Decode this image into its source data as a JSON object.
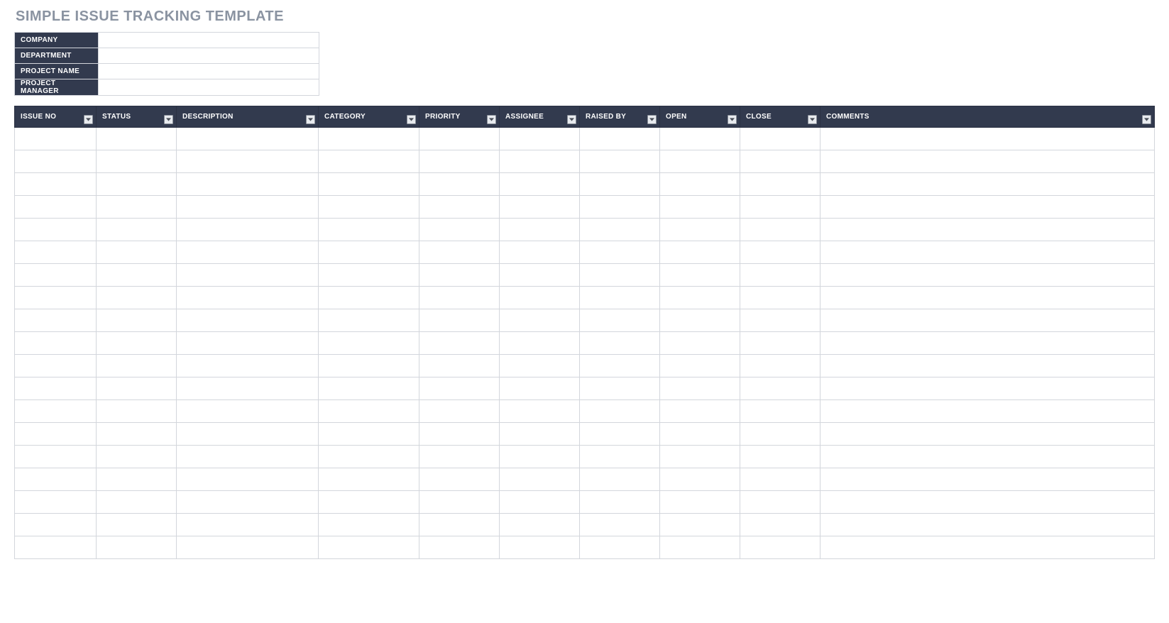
{
  "title": "SIMPLE ISSUE TRACKING TEMPLATE",
  "meta": {
    "rows": [
      {
        "label": "COMPANY",
        "value": ""
      },
      {
        "label": "DEPARTMENT",
        "value": ""
      },
      {
        "label": "PROJECT NAME",
        "value": ""
      },
      {
        "label": "PROJECT MANAGER",
        "value": ""
      }
    ]
  },
  "columns": [
    {
      "key": "issue_no",
      "label": "ISSUE NO"
    },
    {
      "key": "status",
      "label": "STATUS"
    },
    {
      "key": "description",
      "label": "DESCRIPTION"
    },
    {
      "key": "category",
      "label": "CATEGORY"
    },
    {
      "key": "priority",
      "label": "PRIORITY"
    },
    {
      "key": "assignee",
      "label": "ASSIGNEE"
    },
    {
      "key": "raised_by",
      "label": "RAISED BY"
    },
    {
      "key": "open",
      "label": "OPEN"
    },
    {
      "key": "close",
      "label": "CLOSE"
    },
    {
      "key": "comments",
      "label": "COMMENTS"
    }
  ],
  "rows": [
    {
      "issue_no": "",
      "status": "",
      "description": "",
      "category": "",
      "priority": "",
      "assignee": "",
      "raised_by": "",
      "open": "",
      "close": "",
      "comments": ""
    },
    {
      "issue_no": "",
      "status": "",
      "description": "",
      "category": "",
      "priority": "",
      "assignee": "",
      "raised_by": "",
      "open": "",
      "close": "",
      "comments": ""
    },
    {
      "issue_no": "",
      "status": "",
      "description": "",
      "category": "",
      "priority": "",
      "assignee": "",
      "raised_by": "",
      "open": "",
      "close": "",
      "comments": ""
    },
    {
      "issue_no": "",
      "status": "",
      "description": "",
      "category": "",
      "priority": "",
      "assignee": "",
      "raised_by": "",
      "open": "",
      "close": "",
      "comments": ""
    },
    {
      "issue_no": "",
      "status": "",
      "description": "",
      "category": "",
      "priority": "",
      "assignee": "",
      "raised_by": "",
      "open": "",
      "close": "",
      "comments": ""
    },
    {
      "issue_no": "",
      "status": "",
      "description": "",
      "category": "",
      "priority": "",
      "assignee": "",
      "raised_by": "",
      "open": "",
      "close": "",
      "comments": ""
    },
    {
      "issue_no": "",
      "status": "",
      "description": "",
      "category": "",
      "priority": "",
      "assignee": "",
      "raised_by": "",
      "open": "",
      "close": "",
      "comments": ""
    },
    {
      "issue_no": "",
      "status": "",
      "description": "",
      "category": "",
      "priority": "",
      "assignee": "",
      "raised_by": "",
      "open": "",
      "close": "",
      "comments": ""
    },
    {
      "issue_no": "",
      "status": "",
      "description": "",
      "category": "",
      "priority": "",
      "assignee": "",
      "raised_by": "",
      "open": "",
      "close": "",
      "comments": ""
    },
    {
      "issue_no": "",
      "status": "",
      "description": "",
      "category": "",
      "priority": "",
      "assignee": "",
      "raised_by": "",
      "open": "",
      "close": "",
      "comments": ""
    },
    {
      "issue_no": "",
      "status": "",
      "description": "",
      "category": "",
      "priority": "",
      "assignee": "",
      "raised_by": "",
      "open": "",
      "close": "",
      "comments": ""
    },
    {
      "issue_no": "",
      "status": "",
      "description": "",
      "category": "",
      "priority": "",
      "assignee": "",
      "raised_by": "",
      "open": "",
      "close": "",
      "comments": ""
    },
    {
      "issue_no": "",
      "status": "",
      "description": "",
      "category": "",
      "priority": "",
      "assignee": "",
      "raised_by": "",
      "open": "",
      "close": "",
      "comments": ""
    },
    {
      "issue_no": "",
      "status": "",
      "description": "",
      "category": "",
      "priority": "",
      "assignee": "",
      "raised_by": "",
      "open": "",
      "close": "",
      "comments": ""
    },
    {
      "issue_no": "",
      "status": "",
      "description": "",
      "category": "",
      "priority": "",
      "assignee": "",
      "raised_by": "",
      "open": "",
      "close": "",
      "comments": ""
    },
    {
      "issue_no": "",
      "status": "",
      "description": "",
      "category": "",
      "priority": "",
      "assignee": "",
      "raised_by": "",
      "open": "",
      "close": "",
      "comments": ""
    },
    {
      "issue_no": "",
      "status": "",
      "description": "",
      "category": "",
      "priority": "",
      "assignee": "",
      "raised_by": "",
      "open": "",
      "close": "",
      "comments": ""
    },
    {
      "issue_no": "",
      "status": "",
      "description": "",
      "category": "",
      "priority": "",
      "assignee": "",
      "raised_by": "",
      "open": "",
      "close": "",
      "comments": ""
    },
    {
      "issue_no": "",
      "status": "",
      "description": "",
      "category": "",
      "priority": "",
      "assignee": "",
      "raised_by": "",
      "open": "",
      "close": "",
      "comments": ""
    }
  ]
}
